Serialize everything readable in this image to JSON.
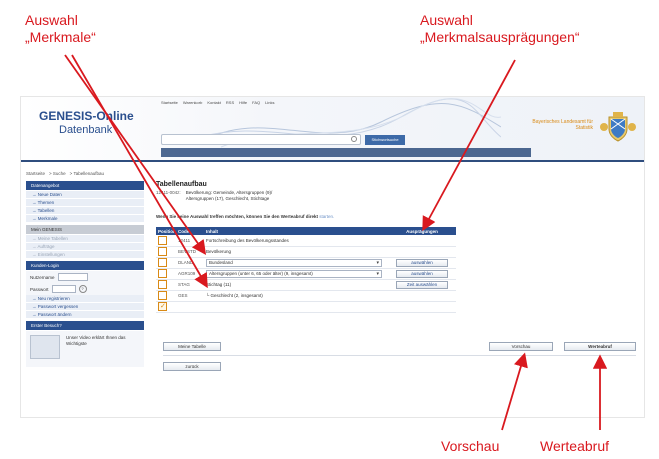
{
  "annotations": {
    "merkmale": "Auswahl\n„Merkmale“",
    "auspraegungen": "Auswahl\n„Merkmalsausprägungen“",
    "vorschau": "Vorschau",
    "werteabruf": "Werteabruf"
  },
  "header": {
    "title": "GENESIS-Online",
    "subtitle": "Datenbank",
    "state_line1": "Bayerisches Landesamt für",
    "state_line2": "Statistik",
    "topnav": [
      "Startseite",
      "Warenkorb",
      "Kontakt",
      "RSS",
      "Hilfe",
      "FAQ",
      "Links"
    ],
    "search_button": "Stichwortsuche"
  },
  "breadcrumb": [
    "Startseite",
    "> Suche",
    "> Tabellenaufbau"
  ],
  "sidebar": {
    "section1": "Datenangebot",
    "items1": [
      "→ Neue Daten",
      "→ Themen",
      "→ Tabellen",
      "→ Merkmale"
    ],
    "section2": "Mein GENESIS",
    "items2": [
      "→ Meine Tabellen",
      "→ Aufträge",
      "→ Einstellungen"
    ],
    "section3": "Kunden-Login",
    "login_user_label": "Nutzername",
    "login_pass_label": "Passwort",
    "help": "?",
    "items3": [
      "→ Neu registrieren",
      "→ Passwort vergessen",
      "→ Passwort ändern"
    ],
    "section4": "Erster Besuch?",
    "promo_text": "Unser Video erklärt Ihnen das Wichtigste"
  },
  "main": {
    "title": "Tabellenaufbau",
    "table_code": "12411-004z:",
    "table_desc1": "Bevölkerung: Gemeinde, Altersgruppen (9)/",
    "table_desc2": "Altersgruppen (17), Geschlecht, Stichtage",
    "hint": "Wenn Sie keine Auswahl treffen möchten, können Sie den Werteabruf direkt",
    "hint_link": "starten.",
    "col_position": "Position",
    "col_code": "Code",
    "col_inhalt": "Inhalt",
    "col_auspraegungen": "Ausprägungen",
    "rows": [
      {
        "code": "12411",
        "inhalt": "Fortschreibung des Bevölkerungsstandes",
        "button": "",
        "checked": false
      },
      {
        "code": "BEVSTD",
        "inhalt": "Bevölkerung",
        "button": "",
        "checked": false
      },
      {
        "code": "DLAND",
        "inhalt": "Bundesland",
        "button": "auswählen",
        "checked": false
      },
      {
        "code": "AGR109",
        "inhalt": "Altersgruppen (unter 6, 65 oder älter) (9, insgesamt)",
        "button": "auswählen",
        "checked": false
      },
      {
        "code": "STAG",
        "inhalt": "Stichtag (11)",
        "button": "Zeit auswählen",
        "checked": false
      },
      {
        "code": "GES",
        "inhalt": "└ Geschlecht (2, insgesamt)",
        "button": "",
        "checked": false
      },
      {
        "code": "",
        "inhalt": "",
        "button": "",
        "checked": true
      }
    ],
    "btn_meine_tabelle": "Meine Tabelle",
    "btn_zurueck": "zurück",
    "btn_vorschau": "Vorschau",
    "btn_werteabruf": "Werteabruf"
  },
  "colors": {
    "annotation": "#d9191f",
    "brand_blue": "#2a4f8e",
    "accent_orange": "#d98a16"
  }
}
